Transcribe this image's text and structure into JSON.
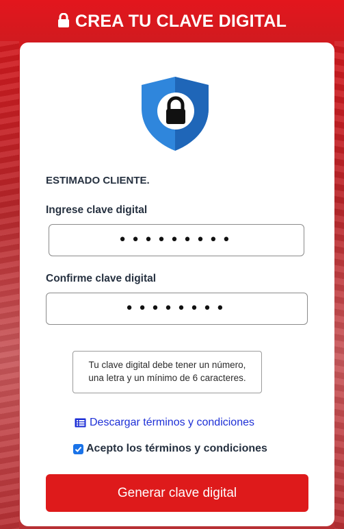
{
  "header": {
    "title": "CREA TU CLAVE DIGITAL",
    "icon": "lock-icon"
  },
  "card": {
    "greeting": "ESTIMADO CLIENTE.",
    "password_label": "Ingrese clave digital",
    "password_value": "•••••••••",
    "confirm_label": "Confirme clave digital",
    "confirm_value": "••••••••",
    "hint_line1": "Tu clave digital debe tener un número,",
    "hint_line2": "una letra y un mínimo de 6 caracteres.",
    "terms_link": "Descargar términos y condiciones",
    "accept_label": "Acepto los términos y condiciones",
    "accept_checked": true,
    "submit_label": "Generar clave digital"
  },
  "colors": {
    "brand_red": "#de1a1b",
    "link_blue": "#1d2fd6",
    "shield_blue": "#2a7fd4",
    "checkbox_blue": "#1a73e8"
  }
}
